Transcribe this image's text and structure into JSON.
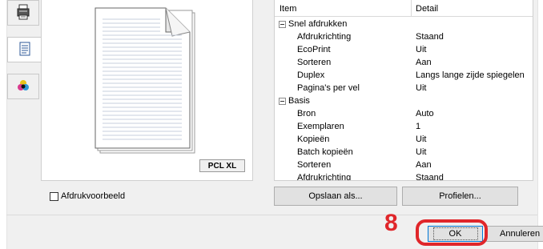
{
  "tabs": [
    {
      "name": "printer-tab",
      "icon": "printer-icon",
      "active": false
    },
    {
      "name": "document-tab",
      "icon": "document-icon",
      "active": true
    },
    {
      "name": "color-tab",
      "icon": "color-balls-icon",
      "active": false
    }
  ],
  "preview": {
    "badge": "PCL XL"
  },
  "table": {
    "headers": {
      "item": "Item",
      "detail": "Detail"
    },
    "rows": [
      {
        "type": "group",
        "item": "Snel afdrukken",
        "detail": ""
      },
      {
        "type": "child",
        "item": "Afdrukrichting",
        "detail": "Staand"
      },
      {
        "type": "child",
        "item": "EcoPrint",
        "detail": "Uit"
      },
      {
        "type": "child",
        "item": "Sorteren",
        "detail": "Aan"
      },
      {
        "type": "child",
        "item": "Duplex",
        "detail": "Langs lange zijde spiegelen"
      },
      {
        "type": "child",
        "item": "Pagina's per vel",
        "detail": "Uit"
      },
      {
        "type": "group",
        "item": "Basis",
        "detail": ""
      },
      {
        "type": "child",
        "item": "Bron",
        "detail": "Auto"
      },
      {
        "type": "child",
        "item": "Exemplaren",
        "detail": "1"
      },
      {
        "type": "child",
        "item": "Kopieën",
        "detail": "Uit"
      },
      {
        "type": "child",
        "item": "Batch kopieën",
        "detail": "Uit"
      },
      {
        "type": "child",
        "item": "Sorteren",
        "detail": "Aan"
      },
      {
        "type": "child",
        "item": "Afdrukrichting",
        "detail": "Staand"
      }
    ]
  },
  "preview_checkbox": {
    "label": "Afdrukvoorbeeld",
    "checked": false
  },
  "buttons": {
    "save_as": "Opslaan als...",
    "profiles": "Profielen...",
    "ok": "OK",
    "cancel": "Annuleren"
  },
  "callout": {
    "step": "8",
    "color": "#e0262a"
  }
}
